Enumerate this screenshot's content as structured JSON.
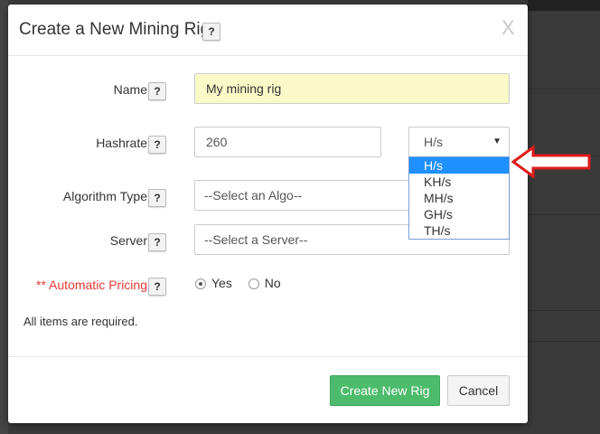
{
  "modal": {
    "title": "Create a New Mining Rig",
    "help": "?",
    "close": "X"
  },
  "form": {
    "name": {
      "label": "Name",
      "help": "?",
      "value": "My mining rig"
    },
    "hashrate": {
      "label": "Hashrate",
      "help": "?",
      "value": "260",
      "unit_selected": "H/s",
      "unit_options": [
        "H/s",
        "KH/s",
        "MH/s",
        "GH/s",
        "TH/s"
      ]
    },
    "algorithm": {
      "label": "Algorithm Type",
      "help": "?",
      "selected": "--Select an Algo--"
    },
    "server": {
      "label": "Server",
      "help": "?",
      "selected": "--Select a Server--"
    },
    "automatic_pricing": {
      "label": "** Automatic Pricing",
      "help": "?",
      "options": [
        "Yes",
        "No"
      ],
      "selected": "Yes"
    },
    "required_note": "All items are required."
  },
  "footer": {
    "create_label": "Create New Rig",
    "cancel_label": "Cancel"
  },
  "colors": {
    "accent_green": "#4cbb6c",
    "highlight_yellow": "#fafac8",
    "warning_red": "#e53935",
    "selected_blue": "#1e90ff"
  }
}
